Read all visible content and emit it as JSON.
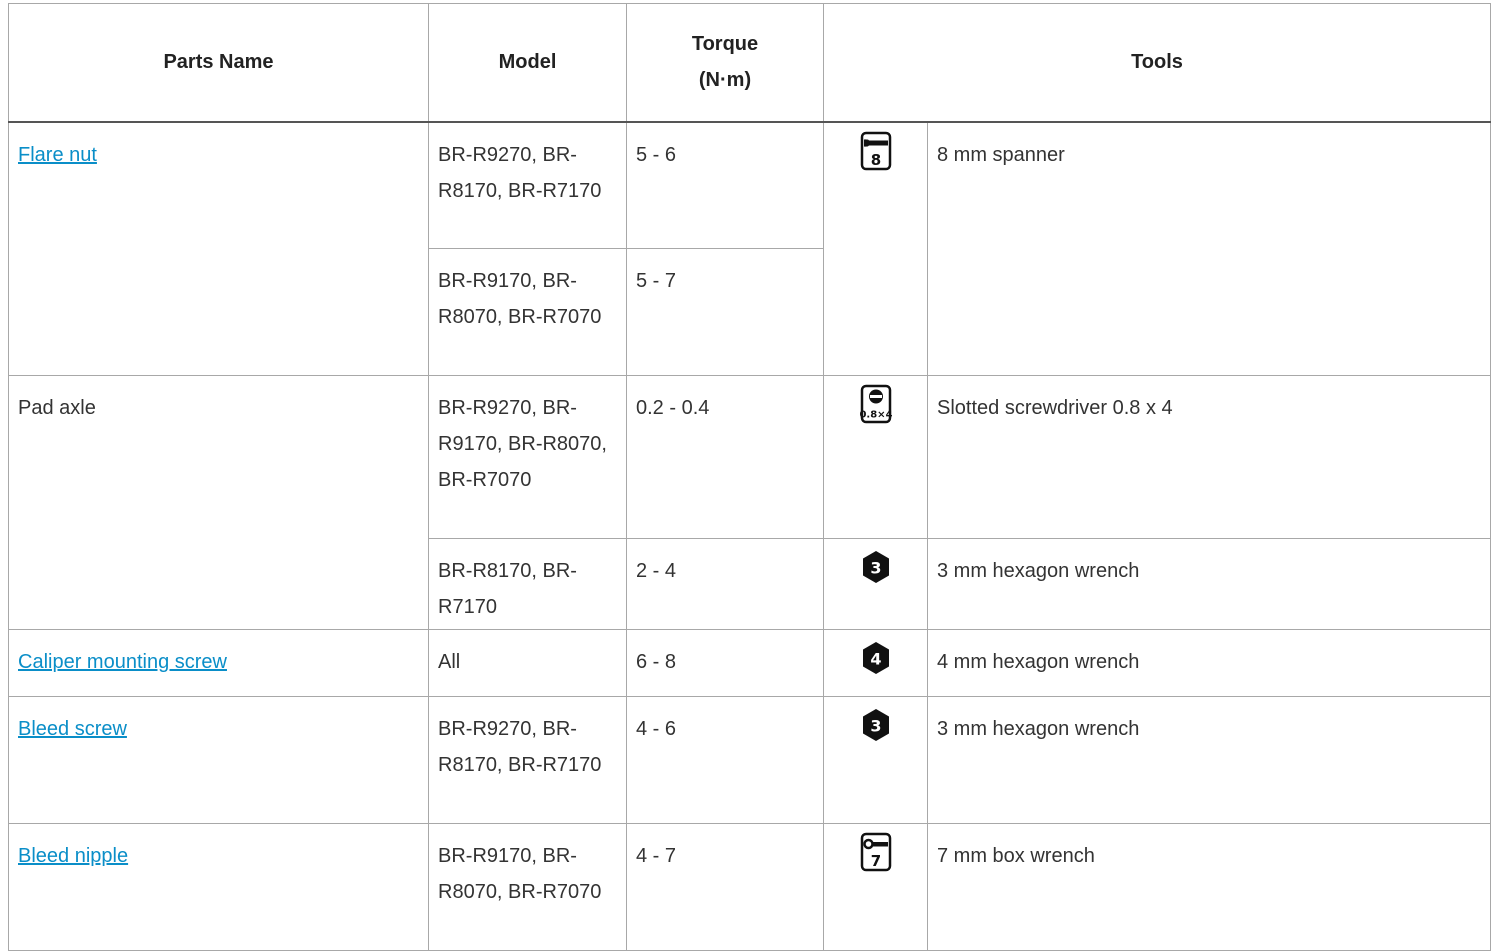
{
  "headers": {
    "parts_name": "Parts Name",
    "model": "Model",
    "torque": "Torque",
    "torque_unit": "(N·m)",
    "tools": "Tools"
  },
  "rows": {
    "flare_nut": {
      "name": "Flare nut",
      "model_a": "BR-R9270, BR-R8170, BR-R7170",
      "torque_a": "5 - 6",
      "model_b": "BR-R9170, BR-R8070, BR-R7070",
      "torque_b": "5 - 7",
      "tool_icon": "spanner-8-icon",
      "tool_icon_label": "8",
      "tool": "8 mm spanner"
    },
    "pad_axle": {
      "name": "Pad axle",
      "model_a": "BR-R9270, BR-R9170, BR-R8070, BR-R7070",
      "torque_a": "0.2 - 0.4",
      "tool_a_icon": "slotted-screwdriver-icon",
      "tool_a_icon_label": "0.8×4",
      "tool_a": "Slotted screwdriver 0.8 x 4",
      "model_b": "BR-R8170, BR-R7170",
      "torque_b": "2 - 4",
      "tool_b_icon": "hexagon-3-icon",
      "tool_b_icon_label": "3",
      "tool_b": "3 mm hexagon wrench"
    },
    "caliper_mounting_screw": {
      "name": "Caliper mounting screw",
      "model": "All",
      "torque": "6 - 8",
      "tool_icon": "hexagon-4-icon",
      "tool_icon_label": "4",
      "tool": "4 mm hexagon wrench"
    },
    "bleed_screw": {
      "name": "Bleed screw",
      "model": "BR-R9270, BR-R8170, BR-R7170",
      "torque": "4 - 6",
      "tool_icon": "hexagon-3-icon",
      "tool_icon_label": "3",
      "tool": "3 mm hexagon wrench"
    },
    "bleed_nipple": {
      "name": "Bleed nipple",
      "model": "BR-R9170, BR-R8070, BR-R7070",
      "torque": "4 - 7",
      "tool_icon": "box-wrench-7-icon",
      "tool_icon_label": "7",
      "tool": "7 mm box wrench"
    }
  },
  "colors": {
    "link": "#0a8ec8",
    "text": "#333333",
    "border": "#a8a8a8",
    "icon": "#111111"
  }
}
